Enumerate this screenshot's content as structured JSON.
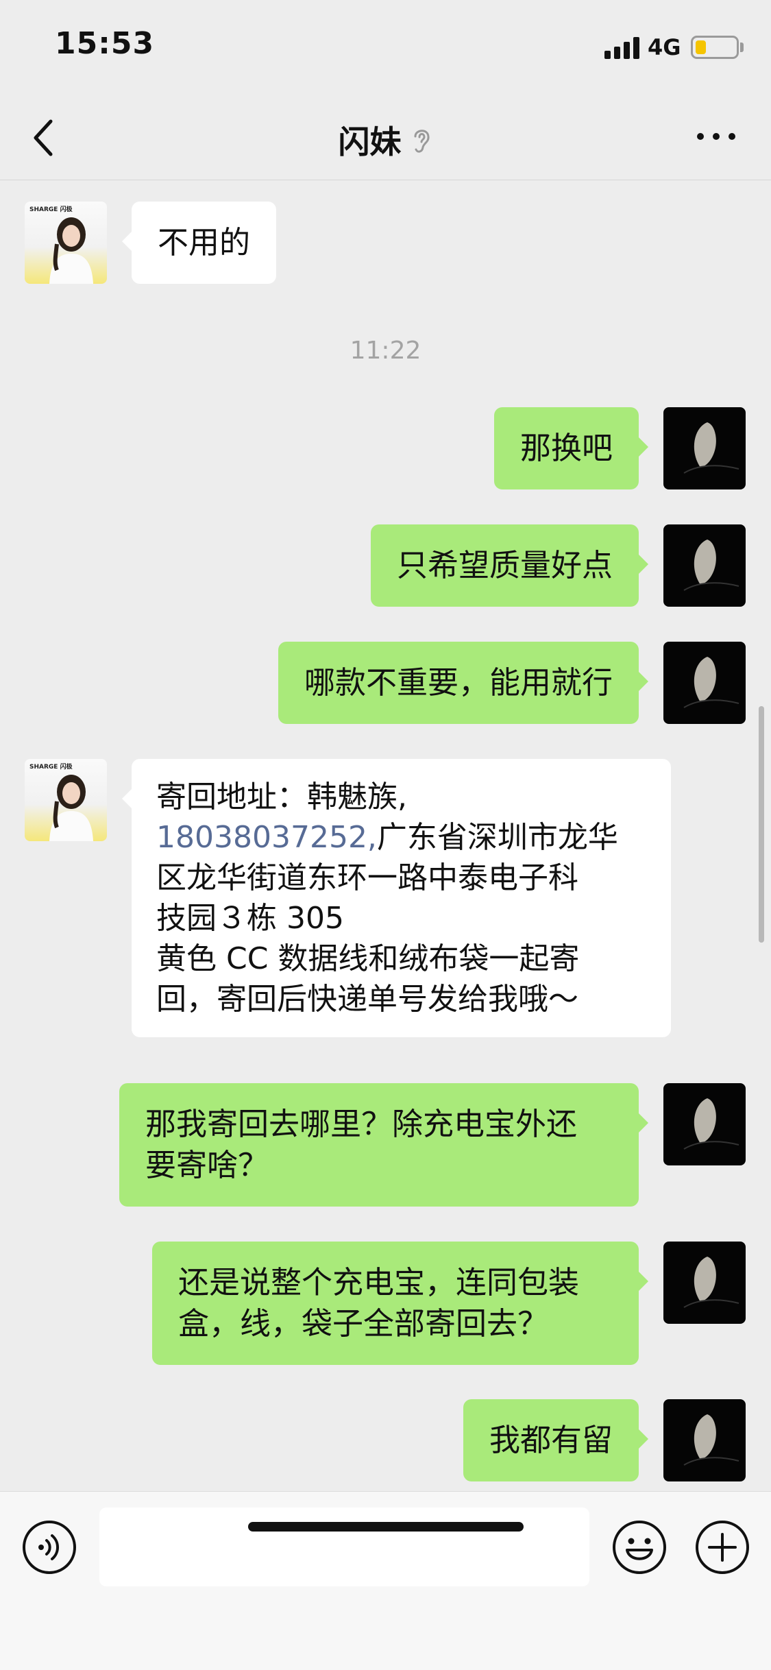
{
  "status_bar": {
    "time": "15:53",
    "network": "4G",
    "battery_level": 0.25,
    "battery_color": "#f5c400"
  },
  "nav": {
    "title": "闪妹",
    "back_icon": "chevron-left-icon",
    "ear_icon": "ear-icon",
    "more_icon": "more-dots-icon"
  },
  "messages": {
    "m1": "不用的",
    "time1": "11:22",
    "m2": "那换吧",
    "m3": "只希望质量好点",
    "m4": "哪款不重要，能用就行",
    "m5": {
      "l1": "寄回地址：韩魅族,",
      "phone": "18038037252,",
      "l2_rest": "广东省深圳市龙华",
      "l3": "区龙华街道东环一路中泰电子科",
      "l4": "技园３栋 305",
      "l5": "黄色 CC 数据线和绒布袋一起寄",
      "l6": "回，寄回后快递单号发给我哦～"
    },
    "m6": {
      "l1": "那我寄回去哪里？除充电宝外还",
      "l2": "要寄啥？"
    },
    "m7": {
      "l1": "还是说整个充电宝，连同包装",
      "l2": "盒，线，袋子全部寄回去？"
    },
    "m8": "我都有留"
  },
  "avatar_them_label": "SHARGE 闪极",
  "colors": {
    "sent_bubble": "#a9ea7a",
    "received_bubble": "#ffffff",
    "link": "#576b95",
    "background": "#ededed"
  },
  "input_bar": {
    "voice_icon": "voice-icon",
    "emoji_icon": "emoji-icon",
    "plus_icon": "plus-icon",
    "input_value": ""
  }
}
